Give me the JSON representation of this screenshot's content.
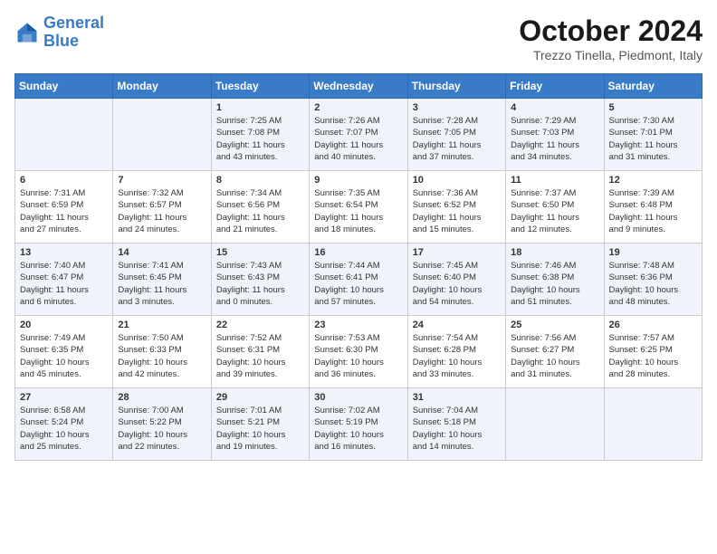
{
  "header": {
    "logo_line1": "General",
    "logo_line2": "Blue",
    "month": "October 2024",
    "location": "Trezzo Tinella, Piedmont, Italy"
  },
  "weekdays": [
    "Sunday",
    "Monday",
    "Tuesday",
    "Wednesday",
    "Thursday",
    "Friday",
    "Saturday"
  ],
  "weeks": [
    [
      {
        "day": "",
        "info": ""
      },
      {
        "day": "",
        "info": ""
      },
      {
        "day": "1",
        "info": "Sunrise: 7:25 AM\nSunset: 7:08 PM\nDaylight: 11 hours\nand 43 minutes."
      },
      {
        "day": "2",
        "info": "Sunrise: 7:26 AM\nSunset: 7:07 PM\nDaylight: 11 hours\nand 40 minutes."
      },
      {
        "day": "3",
        "info": "Sunrise: 7:28 AM\nSunset: 7:05 PM\nDaylight: 11 hours\nand 37 minutes."
      },
      {
        "day": "4",
        "info": "Sunrise: 7:29 AM\nSunset: 7:03 PM\nDaylight: 11 hours\nand 34 minutes."
      },
      {
        "day": "5",
        "info": "Sunrise: 7:30 AM\nSunset: 7:01 PM\nDaylight: 11 hours\nand 31 minutes."
      }
    ],
    [
      {
        "day": "6",
        "info": "Sunrise: 7:31 AM\nSunset: 6:59 PM\nDaylight: 11 hours\nand 27 minutes."
      },
      {
        "day": "7",
        "info": "Sunrise: 7:32 AM\nSunset: 6:57 PM\nDaylight: 11 hours\nand 24 minutes."
      },
      {
        "day": "8",
        "info": "Sunrise: 7:34 AM\nSunset: 6:56 PM\nDaylight: 11 hours\nand 21 minutes."
      },
      {
        "day": "9",
        "info": "Sunrise: 7:35 AM\nSunset: 6:54 PM\nDaylight: 11 hours\nand 18 minutes."
      },
      {
        "day": "10",
        "info": "Sunrise: 7:36 AM\nSunset: 6:52 PM\nDaylight: 11 hours\nand 15 minutes."
      },
      {
        "day": "11",
        "info": "Sunrise: 7:37 AM\nSunset: 6:50 PM\nDaylight: 11 hours\nand 12 minutes."
      },
      {
        "day": "12",
        "info": "Sunrise: 7:39 AM\nSunset: 6:48 PM\nDaylight: 11 hours\nand 9 minutes."
      }
    ],
    [
      {
        "day": "13",
        "info": "Sunrise: 7:40 AM\nSunset: 6:47 PM\nDaylight: 11 hours\nand 6 minutes."
      },
      {
        "day": "14",
        "info": "Sunrise: 7:41 AM\nSunset: 6:45 PM\nDaylight: 11 hours\nand 3 minutes."
      },
      {
        "day": "15",
        "info": "Sunrise: 7:43 AM\nSunset: 6:43 PM\nDaylight: 11 hours\nand 0 minutes."
      },
      {
        "day": "16",
        "info": "Sunrise: 7:44 AM\nSunset: 6:41 PM\nDaylight: 10 hours\nand 57 minutes."
      },
      {
        "day": "17",
        "info": "Sunrise: 7:45 AM\nSunset: 6:40 PM\nDaylight: 10 hours\nand 54 minutes."
      },
      {
        "day": "18",
        "info": "Sunrise: 7:46 AM\nSunset: 6:38 PM\nDaylight: 10 hours\nand 51 minutes."
      },
      {
        "day": "19",
        "info": "Sunrise: 7:48 AM\nSunset: 6:36 PM\nDaylight: 10 hours\nand 48 minutes."
      }
    ],
    [
      {
        "day": "20",
        "info": "Sunrise: 7:49 AM\nSunset: 6:35 PM\nDaylight: 10 hours\nand 45 minutes."
      },
      {
        "day": "21",
        "info": "Sunrise: 7:50 AM\nSunset: 6:33 PM\nDaylight: 10 hours\nand 42 minutes."
      },
      {
        "day": "22",
        "info": "Sunrise: 7:52 AM\nSunset: 6:31 PM\nDaylight: 10 hours\nand 39 minutes."
      },
      {
        "day": "23",
        "info": "Sunrise: 7:53 AM\nSunset: 6:30 PM\nDaylight: 10 hours\nand 36 minutes."
      },
      {
        "day": "24",
        "info": "Sunrise: 7:54 AM\nSunset: 6:28 PM\nDaylight: 10 hours\nand 33 minutes."
      },
      {
        "day": "25",
        "info": "Sunrise: 7:56 AM\nSunset: 6:27 PM\nDaylight: 10 hours\nand 31 minutes."
      },
      {
        "day": "26",
        "info": "Sunrise: 7:57 AM\nSunset: 6:25 PM\nDaylight: 10 hours\nand 28 minutes."
      }
    ],
    [
      {
        "day": "27",
        "info": "Sunrise: 6:58 AM\nSunset: 5:24 PM\nDaylight: 10 hours\nand 25 minutes."
      },
      {
        "day": "28",
        "info": "Sunrise: 7:00 AM\nSunset: 5:22 PM\nDaylight: 10 hours\nand 22 minutes."
      },
      {
        "day": "29",
        "info": "Sunrise: 7:01 AM\nSunset: 5:21 PM\nDaylight: 10 hours\nand 19 minutes."
      },
      {
        "day": "30",
        "info": "Sunrise: 7:02 AM\nSunset: 5:19 PM\nDaylight: 10 hours\nand 16 minutes."
      },
      {
        "day": "31",
        "info": "Sunrise: 7:04 AM\nSunset: 5:18 PM\nDaylight: 10 hours\nand 14 minutes."
      },
      {
        "day": "",
        "info": ""
      },
      {
        "day": "",
        "info": ""
      }
    ]
  ]
}
